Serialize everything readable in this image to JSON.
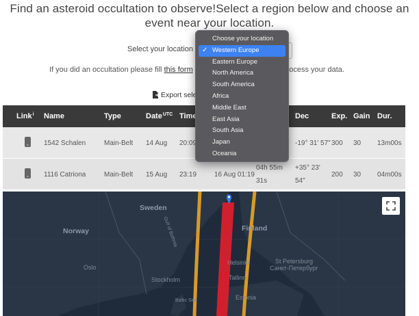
{
  "headline": {
    "line1": "Find an asteroid occultation to observe!Select a region below and choose an",
    "line2": "event near your location."
  },
  "region_select": {
    "label": "Select your location",
    "options": [
      "Choose your location",
      "Western Europe",
      "Eastern Europe",
      "North America",
      "South America",
      "Africa",
      "Middle East",
      "East Asia",
      "South Asia",
      "Japan",
      "Oceania"
    ],
    "selected": "Western Europe"
  },
  "note": {
    "prefix": "If you did an occultation please fill",
    "link": "this form",
    "suffix": "am to process your data."
  },
  "export": {
    "label": "Export sele"
  },
  "table": {
    "headers": {
      "link": "Link",
      "link_sup": "i",
      "name": "Name",
      "type": "Type",
      "date": "Date",
      "date_sup": "UTC",
      "time": "Time",
      "dec": "Dec",
      "exp": "Exp.",
      "gain": "Gain",
      "dur": "Dur."
    },
    "rows": [
      {
        "name": "1542 Schalen",
        "type": "Main-Belt",
        "date": "14 Aug",
        "time": "20:09",
        "dec": "-19° 31' 57\"",
        "exp": "300",
        "gain": "30",
        "dur": "13m00s"
      },
      {
        "name": "1116 Catriona",
        "type": "Main-Belt",
        "date": "15 Aug",
        "time": "23:19",
        "date2": "16 Aug 01:19",
        "ra_line1": "04h 55m",
        "ra_line2": "31s",
        "dec_line1": "+35° 23'",
        "dec_line2": "54\"",
        "exp": "200",
        "gain": "30",
        "dur": "04m00s"
      }
    ]
  },
  "map": {
    "labels": [
      "Sweden",
      "Norway",
      "Oslo",
      "Finland",
      "Helsinki",
      "St Petersburg",
      "Санкт-Петербург",
      "Stockholm",
      "Tallinn",
      "Estonia",
      "Baltic Sea",
      "Gulf of Bothnia"
    ],
    "colors": {
      "water": "#1f2b3b",
      "land": "#2a3645",
      "path": "#d0202e",
      "limits": "#d89a2a",
      "marker": "#3b7de0"
    }
  }
}
